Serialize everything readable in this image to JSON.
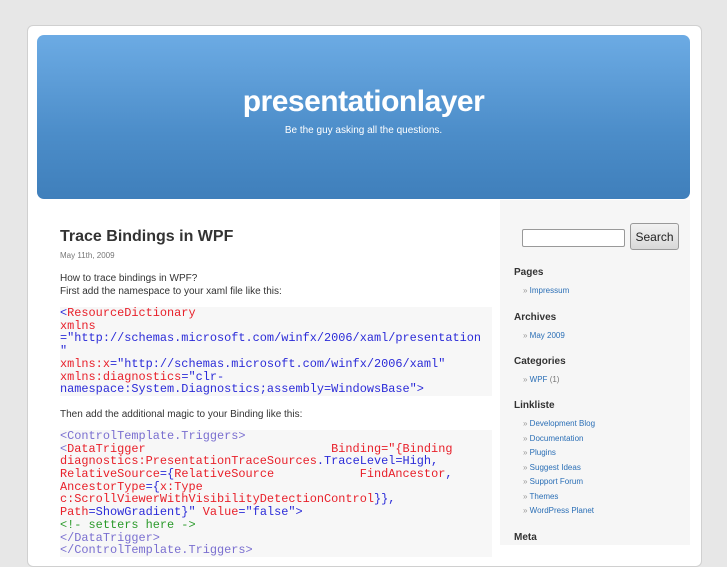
{
  "header": {
    "title": "presentationlayer",
    "description": "Be the guy asking all the questions."
  },
  "post": {
    "title": "Trace Bindings in WPF",
    "date": "May 11th, 2009",
    "intro_line1": "How to trace bindings in WPF?",
    "intro_line2": "First add the namespace to your xaml file like this:",
    "middle": "Then add the additional magic to your Binding like this:",
    "code1": [
      [
        [
          "<",
          "b"
        ],
        [
          "ResourceDictionary",
          "r"
        ]
      ],
      [
        [
          "xmlns",
          "r"
        ]
      ],
      [
        [
          "=\"http://schemas.microsoft.com/winfx/2006/xaml/presentation",
          "b"
        ]
      ],
      [
        [
          "\"",
          "b"
        ]
      ],
      [
        [
          "xmlns:x",
          "r"
        ],
        [
          "=\"http://schemas.microsoft.com/winfx/2006/xaml\"",
          "b"
        ]
      ],
      [
        [
          "xmlns:diagnostics",
          "r"
        ],
        [
          "=\"clr-",
          "b"
        ]
      ],
      [
        [
          "namespace:System.Diagnostics;assembly=WindowsBase\">",
          "b"
        ]
      ]
    ],
    "code2": [
      [
        [
          "<ControlTemplate.Triggers>",
          "p"
        ]
      ],
      [
        [
          "<",
          "p"
        ],
        [
          "DataTrigger                          Binding",
          "r"
        ],
        [
          "=\"{Binding",
          "r"
        ]
      ],
      [
        [
          "diagnostics:PresentationTraceSources",
          "r"
        ],
        [
          ".TraceLevel=High,",
          "b"
        ]
      ],
      [
        [
          "RelativeSource",
          "r"
        ],
        [
          "={",
          "b"
        ],
        [
          "RelativeSource            FindAncestor",
          "r"
        ],
        [
          ",",
          "b"
        ]
      ],
      [
        [
          "AncestorType",
          "r"
        ],
        [
          "={",
          "b"
        ],
        [
          "x:Type",
          "r"
        ]
      ],
      [
        [
          "c:ScrollViewerWithVisibilityDetectionControl",
          "r"
        ],
        [
          "}},",
          "b"
        ]
      ],
      [
        [
          "Path",
          "r"
        ],
        [
          "=ShowGradient}\"",
          "b"
        ],
        [
          " Value",
          "r"
        ],
        [
          "=\"false\">",
          "b"
        ]
      ],
      [
        [
          "<!- setters here ->",
          "g"
        ]
      ],
      [
        [
          "</DataTrigger>",
          "p"
        ]
      ],
      [
        [
          "</ControlTemplate.Triggers>",
          "p"
        ]
      ]
    ]
  },
  "sidebar": {
    "search_label": "Search",
    "search_value": "",
    "pages_title": "Pages",
    "pages": [
      "Impressum"
    ],
    "archives_title": "Archives",
    "archives": [
      "May 2009"
    ],
    "categories_title": "Categories",
    "categories": [
      {
        "name": "WPF",
        "count": "(1)"
      }
    ],
    "links_title": "Linkliste",
    "links": [
      "Development Blog",
      "Documentation",
      "Plugins",
      "Suggest Ideas",
      "Support Forum",
      "Themes",
      "WordPress Planet"
    ],
    "meta_title": "Meta"
  },
  "colors": {
    "r": "#e8202a",
    "b": "#2b2bd8",
    "p": "#7a6fd0",
    "g": "#2a9a2a"
  }
}
